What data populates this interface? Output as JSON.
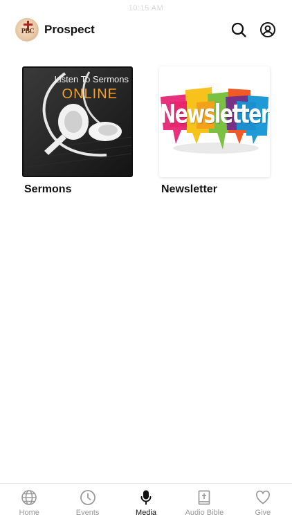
{
  "status_bar": {
    "time": "10:15 AM"
  },
  "header": {
    "title": "Prospect",
    "logo_text": "PBC"
  },
  "media_items": [
    {
      "label": "Sermons",
      "image_line1": "Listen To Sermons",
      "image_line2": "ONLINE"
    },
    {
      "label": "Newsletter",
      "image_text": "Newsletter"
    }
  ],
  "tabs": [
    {
      "label": "Home",
      "icon": "globe-icon",
      "active": false
    },
    {
      "label": "Events",
      "icon": "clock-icon",
      "active": false
    },
    {
      "label": "Media",
      "icon": "microphone-icon",
      "active": true
    },
    {
      "label": "Audio Bible",
      "icon": "bible-icon",
      "active": false
    },
    {
      "label": "Give",
      "icon": "heart-icon",
      "active": false
    }
  ],
  "colors": {
    "active_tab": "#111111",
    "inactive_tab": "#9a9a9a",
    "online_text": "#f0a030"
  }
}
